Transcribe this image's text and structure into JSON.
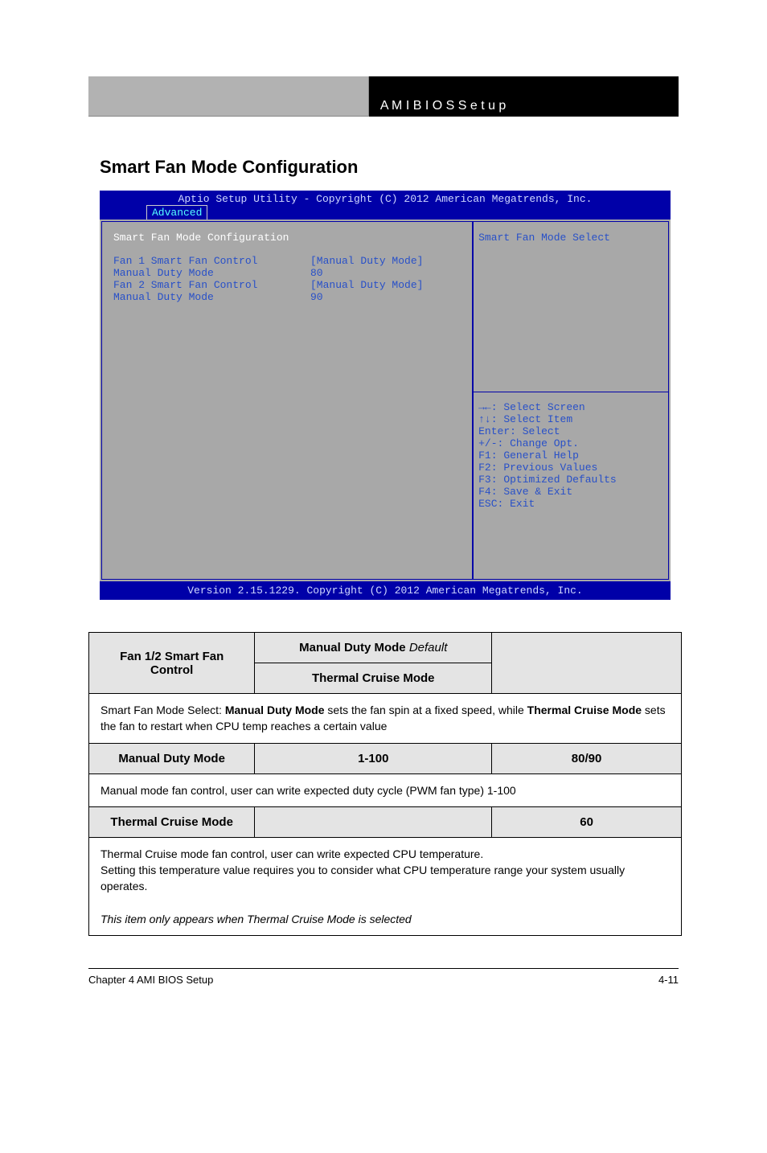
{
  "header_right": "A M I   B I O S   S e t u p",
  "section_title": "Smart Fan Mode Configuration",
  "bios": {
    "title": "Aptio Setup Utility - Copyright (C) 2012 American Megatrends, Inc.",
    "tab": "Advanced",
    "heading": "Smart Fan Mode Configuration",
    "rows": [
      {
        "label": "Fan 1 Smart Fan Control",
        "value": "[Manual Duty Mode]"
      },
      {
        "label": "Manual Duty Mode",
        "value": "80"
      },
      {
        "label": "Fan 2 Smart Fan Control",
        "value": "[Manual Duty Mode]"
      },
      {
        "label": "Manual Duty Mode",
        "value": "90"
      }
    ],
    "help": "Smart Fan  Mode Select",
    "keys": [
      "→←: Select Screen",
      "↑↓: Select Item",
      "Enter: Select",
      "+/-: Change Opt.",
      "F1: General Help",
      "F2: Previous Values",
      "F3: Optimized Defaults",
      "F4: Save & Exit",
      "ESC: Exit"
    ],
    "footer": "Version 2.15.1229. Copyright (C) 2012 American Megatrends, Inc."
  },
  "table": {
    "row1": {
      "c1": "Fan 1/2 Smart Fan Control",
      "c2a": "Manual Duty Mode",
      "c2b": "Thermal Cruise Mode",
      "c3": "Default"
    },
    "desc1_prefix": "Smart Fan Mode Select: ",
    "desc1_opt1": "Manual Duty Mode",
    "desc1_mid1": " sets the fan spin at a fixed speed, while ",
    "desc1_opt2": "Thermal Cruise Mode",
    "desc1_mid2": " sets the fan to restart when CPU temp reaches a certain value",
    "row2": {
      "c1": "Manual Duty Mode",
      "c2": "1-100",
      "c3": "80/90"
    },
    "desc2": "Manual mode fan control, user can write expected duty cycle (PWM fan type) 1-100",
    "row3": {
      "c1": "Thermal Cruise Mode",
      "c2": "",
      "c3": "60"
    },
    "desc3_prefix": "Thermal Cruise mode fan control, user can write expected CPU temperature.\nSetting this temperature value requires you to consider what CPU temperature range your system usually operates.\n\n",
    "desc3_italic": "This item only appears when Thermal Cruise Mode is selected"
  },
  "footer": {
    "chapter": "Chapter 4 AMI BIOS Setup",
    "page": "4-11"
  }
}
